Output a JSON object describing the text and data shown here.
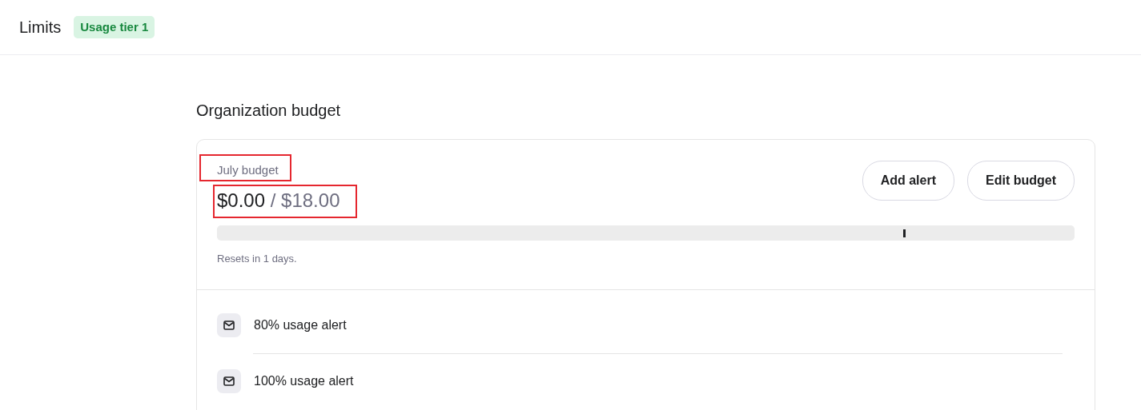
{
  "header": {
    "title": "Limits",
    "badge": "Usage tier 1"
  },
  "section_title": "Organization budget",
  "budget": {
    "label": {
      "text": "July budget",
      "highlighted": true
    },
    "amount": {
      "spent": "$0.00",
      "separator": "/",
      "limit": "$18.00",
      "highlighted": true
    },
    "progress": {
      "level": 0
    },
    "threshold_marker": {
      "level": 0.8
    },
    "reset_note": "Resets in 1 days.",
    "buttons": [
      "Add alert",
      "Edit budget"
    ]
  },
  "alerts": [
    {
      "label": "80% usage alert"
    },
    {
      "label": "100% usage alert"
    }
  ]
}
